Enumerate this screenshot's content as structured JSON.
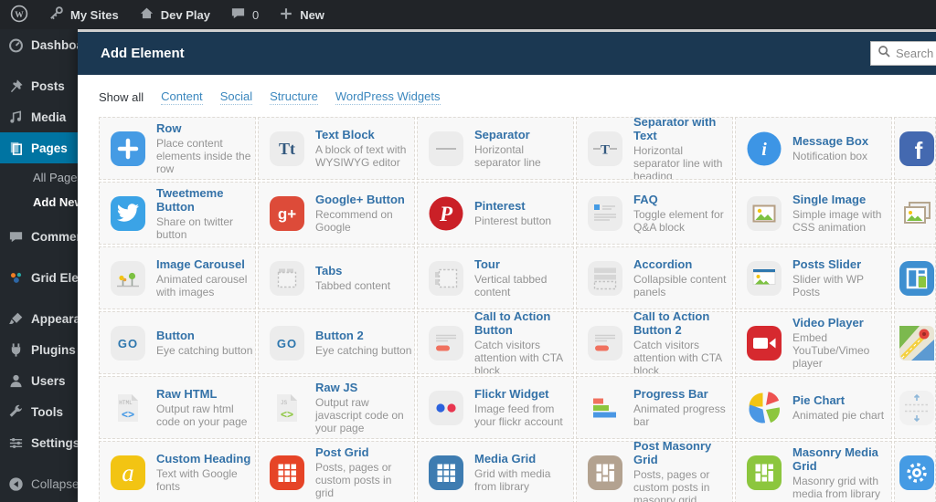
{
  "admin_bar": {
    "my_sites": "My Sites",
    "site_name": "Dev Play",
    "comments_count": "0",
    "new_label": "New"
  },
  "sidebar": {
    "items": [
      {
        "icon": "dashboard",
        "label": "Dashboard"
      },
      {
        "icon": "pushpin",
        "label": "Posts"
      },
      {
        "icon": "media",
        "label": "Media"
      },
      {
        "icon": "pages",
        "label": "Pages",
        "active": true
      },
      {
        "icon": "comments",
        "label": "Comments"
      },
      {
        "icon": "grid-elements",
        "label": "Grid Elements"
      },
      {
        "icon": "appearance-brush",
        "label": "Appearance"
      },
      {
        "icon": "plugin",
        "label": "Plugins"
      },
      {
        "icon": "users",
        "label": "Users"
      },
      {
        "icon": "wrench",
        "label": "Tools"
      },
      {
        "icon": "settings-sliders",
        "label": "Settings"
      }
    ],
    "pages_submenu": [
      {
        "label": "All Pages"
      },
      {
        "label": "Add New",
        "current": true
      }
    ],
    "collapse_label": "Collapse menu"
  },
  "modal": {
    "title": "Add Element",
    "search_placeholder": "Search",
    "filters": [
      {
        "label": "Show all",
        "active": true
      },
      {
        "label": "Content"
      },
      {
        "label": "Social"
      },
      {
        "label": "Structure"
      },
      {
        "label": "WordPress Widgets"
      }
    ],
    "accent_colors": {
      "header_bg": "#1b3852",
      "title_blue": "#3472a8",
      "link_blue": "#3b87be"
    },
    "elements": [
      {
        "title": "Row",
        "desc": "Place content elements inside the row",
        "icon": "row-plus"
      },
      {
        "title": "Text Block",
        "desc": "A block of text with WYSIWYG editor",
        "icon": "text-block"
      },
      {
        "title": "Separator",
        "desc": "Horizontal separator line",
        "icon": "separator"
      },
      {
        "title": "Separator with Text",
        "desc": "Horizontal separator line with heading",
        "icon": "separator-text"
      },
      {
        "title": "Message Box",
        "desc": "Notification box",
        "icon": "message-box"
      },
      {
        "icon": "facebook",
        "cut": true
      },
      {
        "title": "Tweetmeme Button",
        "desc": "Share on twitter button",
        "icon": "twitter"
      },
      {
        "title": "Google+ Button",
        "desc": "Recommend on Google",
        "icon": "googleplus"
      },
      {
        "title": "Pinterest",
        "desc": "Pinterest button",
        "icon": "pinterest"
      },
      {
        "title": "FAQ",
        "desc": "Toggle element for Q&A block",
        "icon": "faq-list"
      },
      {
        "title": "Single Image",
        "desc": "Simple image with CSS animation",
        "icon": "single-image"
      },
      {
        "icon": "image-gallery",
        "cut": true
      },
      {
        "title": "Image Carousel",
        "desc": "Animated carousel with images",
        "icon": "image-carousel"
      },
      {
        "title": "Tabs",
        "desc": "Tabbed content",
        "icon": "tabs"
      },
      {
        "title": "Tour",
        "desc": "Vertical tabbed content",
        "icon": "tour"
      },
      {
        "title": "Accordion",
        "desc": "Collapsible content panels",
        "icon": "accordion"
      },
      {
        "title": "Posts Slider",
        "desc": "Slider with WP Posts",
        "icon": "posts-slider"
      },
      {
        "icon": "widget-layout",
        "cut": true
      },
      {
        "title": "Button",
        "desc": "Eye catching button",
        "icon": "go-button"
      },
      {
        "title": "Button 2",
        "desc": "Eye catching button",
        "icon": "go-button"
      },
      {
        "title": "Call to Action Button",
        "desc": "Catch visitors attention with CTA block",
        "icon": "cta-block"
      },
      {
        "title": "Call to Action Button 2",
        "desc": "Catch visitors attention with CTA block",
        "icon": "cta-block"
      },
      {
        "title": "Video Player",
        "desc": "Embed YouTube/Vimeo player",
        "icon": "video-player"
      },
      {
        "icon": "google-maps",
        "cut": true
      },
      {
        "title": "Raw HTML",
        "desc": "Output raw html code on your page",
        "icon": "raw-html"
      },
      {
        "title": "Raw JS",
        "desc": "Output raw javascript code on your page",
        "icon": "raw-js"
      },
      {
        "title": "Flickr Widget",
        "desc": "Image feed from your flickr account",
        "icon": "flickr"
      },
      {
        "title": "Progress Bar",
        "desc": "Animated progress bar",
        "icon": "progress-bar"
      },
      {
        "title": "Pie Chart",
        "desc": "Animated pie chart",
        "icon": "pie-chart"
      },
      {
        "icon": "empty-space",
        "cut": true
      },
      {
        "title": "Custom Heading",
        "desc": "Text with Google fonts",
        "icon": "custom-heading"
      },
      {
        "title": "Post Grid",
        "desc": "Posts, pages or custom posts in grid",
        "icon": "post-grid"
      },
      {
        "title": "Media Grid",
        "desc": "Grid with media from library",
        "icon": "media-grid"
      },
      {
        "title": "Post Masonry Grid",
        "desc": "Posts, pages or custom posts in masonry grid",
        "icon": "post-masonry-grid"
      },
      {
        "title": "Masonry Media Grid",
        "desc": "Masonry grid with media from library",
        "icon": "masonry-media-grid"
      },
      {
        "icon": "gear",
        "cut": true
      }
    ]
  }
}
